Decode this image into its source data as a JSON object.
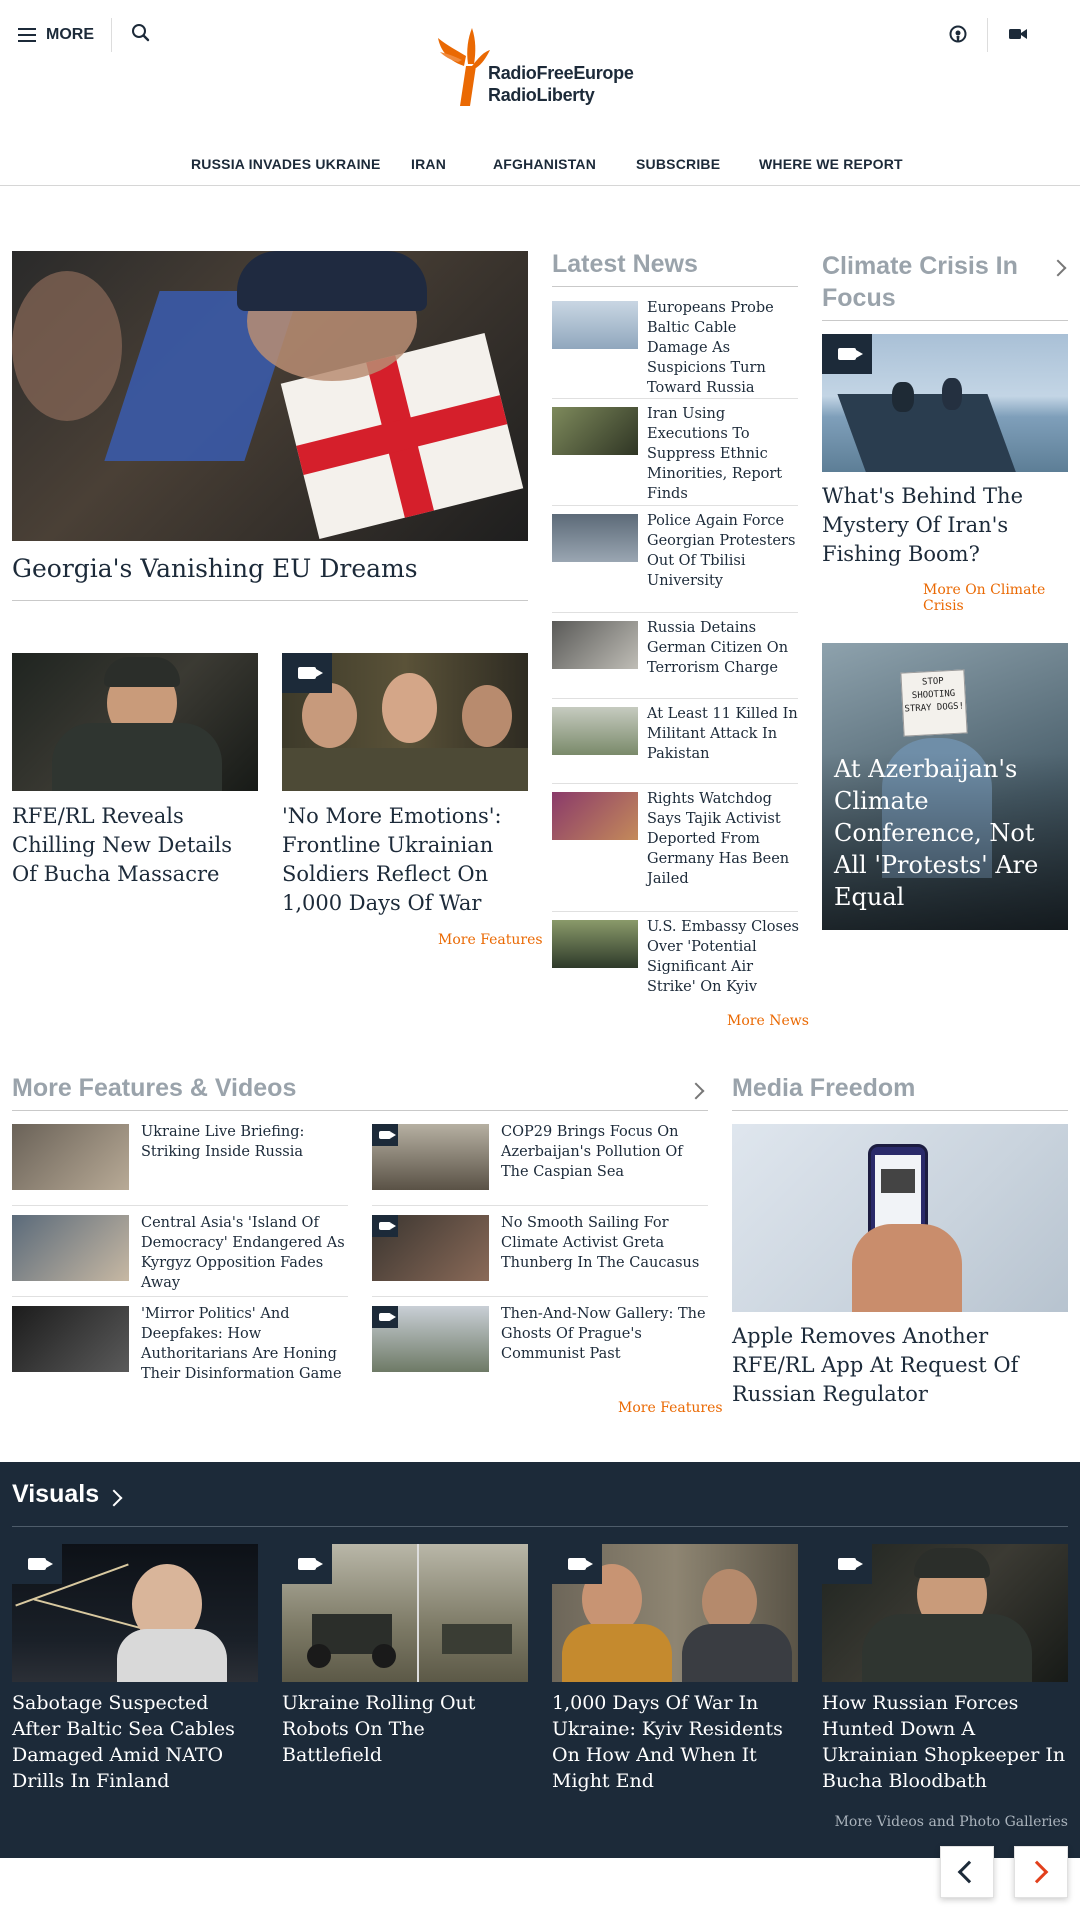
{
  "header": {
    "menu_label": "MORE",
    "logo_line1": "RadioFreeEurope",
    "logo_line2": "RadioLiberty",
    "nav": [
      "RUSSIA INVADES UKRAINE",
      "IRAN",
      "AFGHANISTAN",
      "SUBSCRIBE",
      "WHERE WE REPORT"
    ]
  },
  "colors": {
    "accent": "#ea6903",
    "navy": "#1c2a39",
    "section_title": "#9aa3ab"
  },
  "lead": {
    "title": "Georgia's Vanishing EU Dreams",
    "features": [
      {
        "title": "RFE/RL Reveals Chilling New Details Of Bucha Massacre",
        "video": false
      },
      {
        "title": "'No More Emotions': Frontline Ukrainian Soldiers Reflect On 1,000 Days Of War",
        "video": true
      }
    ],
    "more": "More Features"
  },
  "latest": {
    "title": "Latest News",
    "items": [
      "Europeans Probe Baltic Cable Damage As Suspicions Turn Toward Russia",
      "Iran Using Executions To Suppress Ethnic Minorities, Report Finds",
      "Police Again Force Georgian Protesters Out Of Tbilisi University",
      "Russia Detains German Citizen On Terrorism Charge",
      "At Least 11 Killed In Militant Attack In Pakistan",
      "Rights Watchdog Says Tajik Activist Deported From Germany Has Been Jailed",
      "U.S. Embassy Closes Over 'Potential Significant Air Strike' On Kyiv"
    ],
    "more": "More News"
  },
  "climate": {
    "title": "Climate Crisis In Focus",
    "story": "What's Behind The Mystery Of Iran's Fishing Boom?",
    "more": "More On Climate Crisis",
    "promo": "At Azerbaijan's Climate Conference, Not All 'Protests' Are Equal",
    "sign_text": "STOP SHOOTING STRAY DOGS!"
  },
  "features_videos": {
    "title": "More Features & Videos",
    "left": [
      "Ukraine Live Briefing: Striking Inside Russia",
      "Central Asia's 'Island Of Democracy' Endangered As Kyrgyz Opposition Fades Away",
      "'Mirror Politics' And Deepfakes: How Authoritarians Are Honing Their Disinformation Game"
    ],
    "right": [
      "COP29 Brings Focus On Azerbaijan's Pollution Of The Caspian Sea",
      "No Smooth Sailing For Climate Activist Greta Thunberg In The Caucasus",
      "Then-And-Now Gallery: The Ghosts Of Prague's Communist Past"
    ],
    "more": "More Features"
  },
  "media_freedom": {
    "title": "Media Freedom",
    "story": "Apple Removes Another RFE/RL App At Request Of Russian Regulator"
  },
  "visuals": {
    "title": "Visuals",
    "items": [
      "Sabotage Suspected After Baltic Sea Cables Damaged Amid NATO Drills In Finland",
      "Ukraine Rolling Out Robots On The Battlefield",
      "1,000 Days Of War In Ukraine: Kyiv Residents On How And When It Might End",
      "How Russian Forces Hunted Down A Ukrainian Shopkeeper In Bucha Bloodbath"
    ],
    "more": "More Videos and Photo Galleries"
  }
}
